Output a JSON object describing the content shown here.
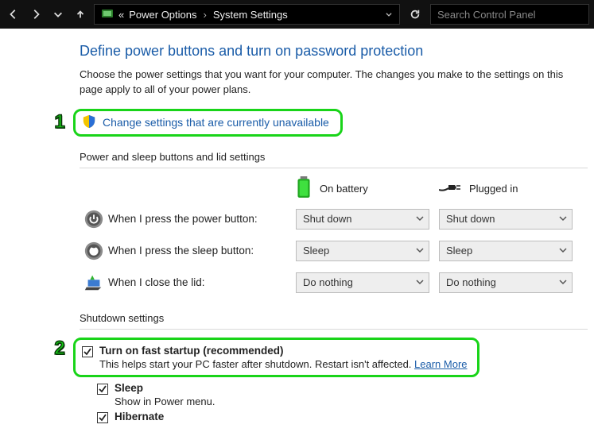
{
  "titlebar": {
    "breadcrumb_pre": "«",
    "breadcrumb_1": "Power Options",
    "breadcrumb_2": "System Settings",
    "search_placeholder": "Search Control Panel"
  },
  "page": {
    "title": "Define power buttons and turn on password protection",
    "subtitle": "Choose the power settings that you want for your computer. The changes you make to the settings on this page apply to all of your power plans.",
    "unlock_link": "Change settings that are currently unavailable"
  },
  "annotations": {
    "one": "1",
    "two": "2"
  },
  "buttons_section": {
    "header": "Power and sleep buttons and lid settings",
    "col_battery": "On battery",
    "col_plugged": "Plugged in",
    "rows": [
      {
        "label": "When I press the power button:",
        "battery": "Shut down",
        "plugged": "Shut down"
      },
      {
        "label": "When I press the sleep button:",
        "battery": "Sleep",
        "plugged": "Sleep"
      },
      {
        "label": "When I close the lid:",
        "battery": "Do nothing",
        "plugged": "Do nothing"
      }
    ]
  },
  "shutdown_section": {
    "header": "Shutdown settings",
    "fast_startup_label": "Turn on fast startup (recommended)",
    "fast_startup_desc": "This helps start your PC faster after shutdown. Restart isn't affected. ",
    "learn_more": "Learn More",
    "sleep_label": "Sleep",
    "sleep_desc": "Show in Power menu.",
    "hibernate_label": "Hibernate"
  }
}
